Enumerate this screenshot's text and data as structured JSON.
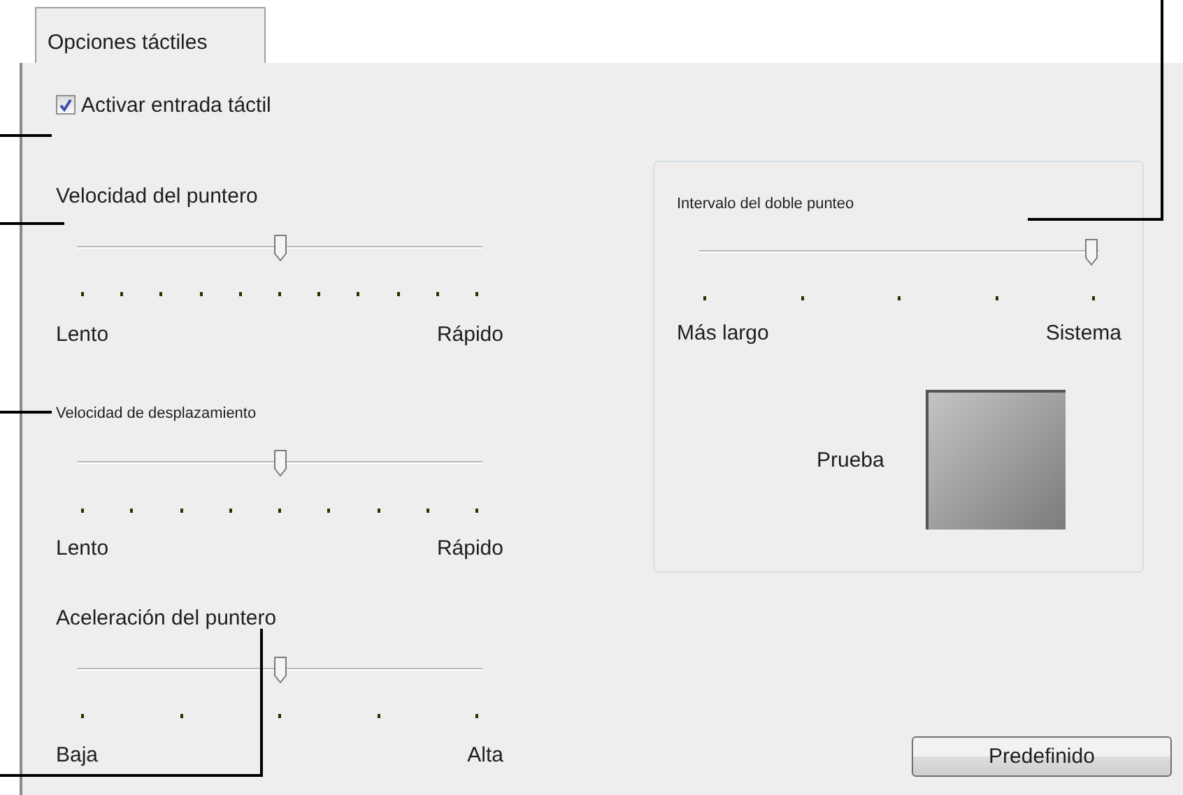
{
  "tab": {
    "label": "Opciones táctiles",
    "selected": true
  },
  "checkbox": {
    "label": "Activar entrada táctil",
    "checked": true
  },
  "sliders": [
    {
      "label": "Velocidad del puntero",
      "level": 0.5,
      "min_label": "Lento",
      "max_label": "Rápido"
    },
    {
      "label": "Velocidad de desplazamiento",
      "level": 0.5,
      "min_label": "Lento",
      "max_label": "Rápido"
    },
    {
      "label": "Aceleración del puntero",
      "level": 0.5,
      "min_label": "Baja",
      "max_label": "Alta"
    }
  ],
  "double_tap": {
    "slider": {
      "label": "Intervalo del doble punteo",
      "level": 1,
      "min_label": "Más largo",
      "max_label": "Sistema"
    },
    "test_label": "Prueba"
  },
  "button": "Predefinido"
}
